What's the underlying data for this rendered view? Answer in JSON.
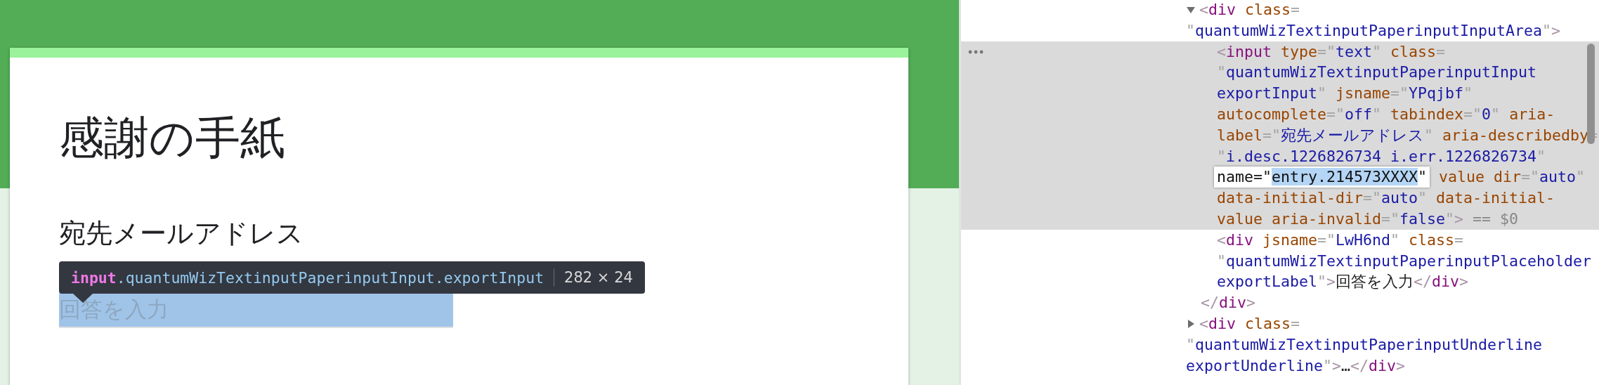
{
  "form": {
    "title": "感謝の手紙",
    "questions": [
      {
        "label": "宛先メールアドレス",
        "placeholder": "回答を入力",
        "highlighted": true
      }
    ],
    "tooltip": {
      "tag": "input",
      "classes": ".quantumWizTextinputPaperinputInput.exportInput",
      "size": "282 × 24"
    }
  },
  "devtools": {
    "nodes": [
      {
        "expanded": true,
        "selected": false,
        "lines": [
          {
            "code": "<div class="
          },
          {
            "code": "\"quantumWizTextinputPaperinputInputArea\">"
          }
        ],
        "children": [
          {
            "selected": true,
            "lines": [
              {
                "code": "<input type=\"text\" class="
              },
              {
                "code": "\"quantumWizTextinputPaperinputInput"
              },
              {
                "code": "exportInput\" jsname=\"YPqjbf\""
              },
              {
                "code": "autocomplete=\"off\" tabindex=\"0\" aria-"
              },
              {
                "code": "label=\"宛先メールアドレス\" aria-describedby="
              },
              {
                "code": "\"i.desc.1226826734 i.err.1226826734\""
              },
              {
                "editor": {
                  "before": "name=\"",
                  "selection": "entry.214573XXXX",
                  "after": "\""
                },
                "code": " value dir=\"auto\""
              },
              {
                "code": "data-initial-dir=\"auto\" data-initial-"
              },
              {
                "code": "value aria-invalid=\"false\">",
                "console_ref": "== $0"
              }
            ]
          },
          {
            "selected": false,
            "lines": [
              {
                "code": "<div jsname=\"LwH6nd\" class="
              },
              {
                "code": "\"quantumWizTextinputPaperinputPlaceholder"
              },
              {
                "code": "exportLabel\">回答を入力</div>"
              }
            ]
          }
        ],
        "closing": "</div>"
      },
      {
        "expanded": false,
        "selected": false,
        "lines": [
          {
            "code": "<div class="
          },
          {
            "code": "\"quantumWizTextinputPaperinputUnderline"
          },
          {
            "code": "exportUnderline\">…</div>"
          }
        ]
      }
    ]
  }
}
